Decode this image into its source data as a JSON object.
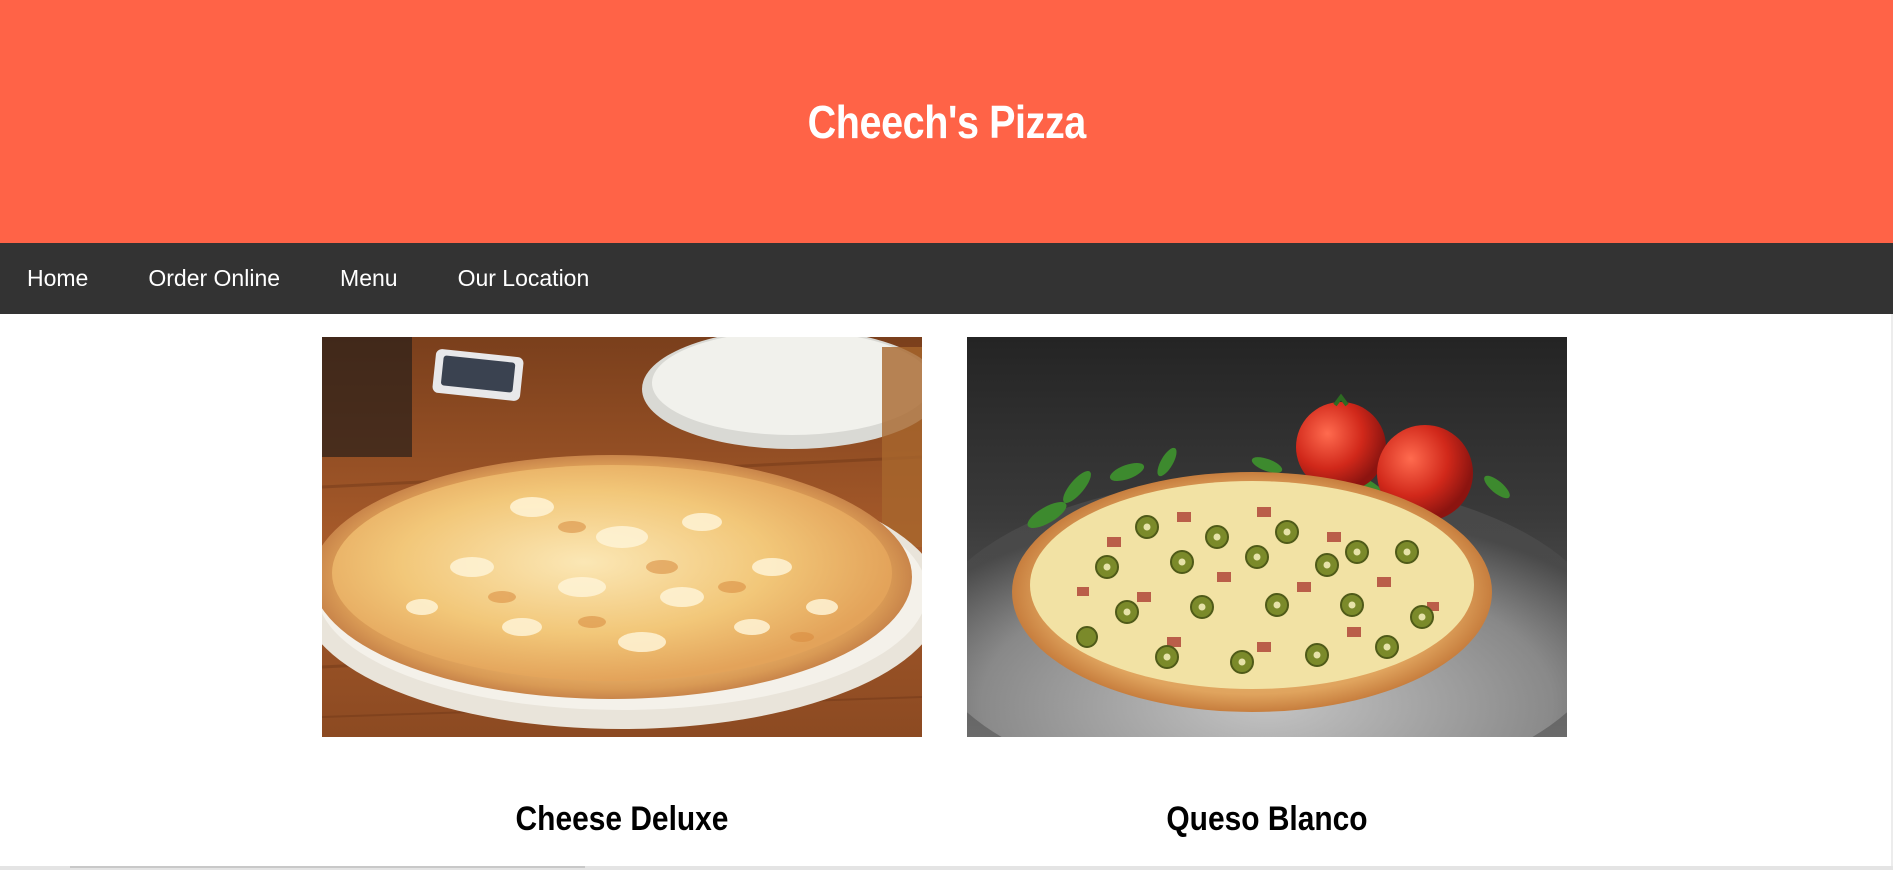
{
  "header": {
    "title": "Cheech's Pizza",
    "background_color": "#ff6347"
  },
  "nav": {
    "background_color": "#333333",
    "items": [
      {
        "label": "Home"
      },
      {
        "label": "Order Online"
      },
      {
        "label": "Menu"
      },
      {
        "label": "Our Location"
      }
    ]
  },
  "products": [
    {
      "name": "Cheese Deluxe",
      "image": "cheese-pizza-photo"
    },
    {
      "name": "Queso Blanco",
      "image": "olive-pizza-photo"
    }
  ]
}
